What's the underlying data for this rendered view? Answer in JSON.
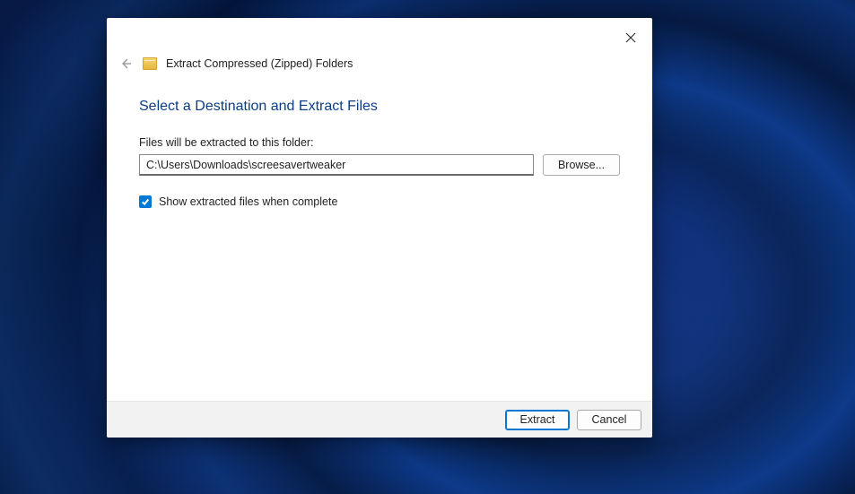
{
  "dialog": {
    "title": "Extract Compressed (Zipped) Folders",
    "heading": "Select a Destination and Extract Files",
    "path_label": "Files will be extracted to this folder:",
    "path_value": "C:\\Users\\Downloads\\screesavertweaker",
    "browse_label": "Browse...",
    "checkbox_label": "Show extracted files when complete",
    "checkbox_checked": true,
    "extract_label": "Extract",
    "cancel_label": "Cancel"
  }
}
